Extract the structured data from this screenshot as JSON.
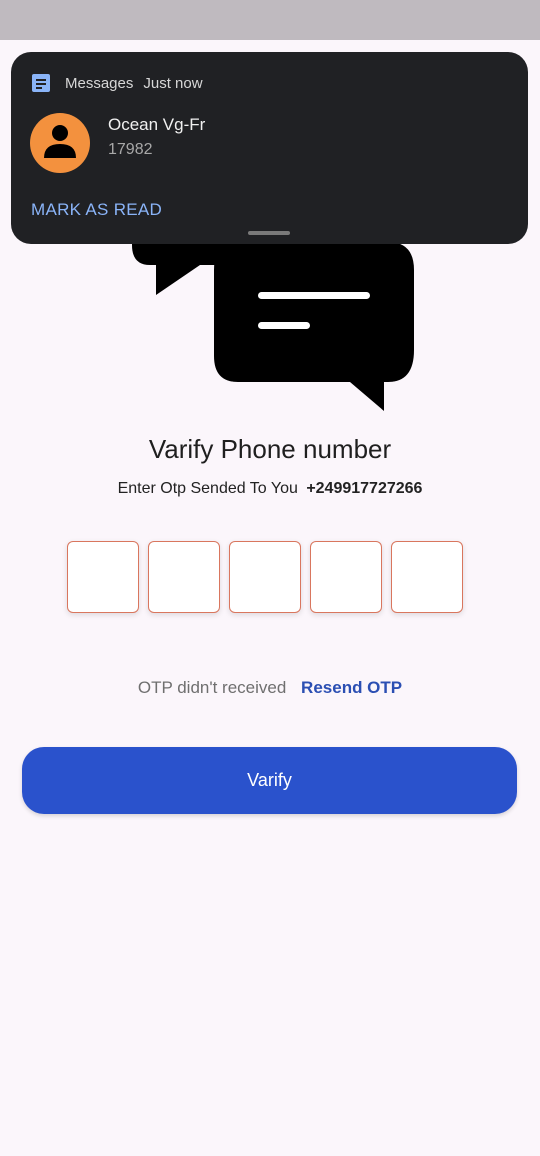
{
  "notification": {
    "app_name": "Messages",
    "time": "Just now",
    "sender": "Ocean Vg-Fr",
    "message": "17982",
    "action_label": "MARK AS READ",
    "icons": {
      "app": "messages-icon",
      "avatar": "person-icon"
    },
    "colors": {
      "background": "#202124",
      "action": "#8ab4f8",
      "avatar": "#f3913e"
    }
  },
  "verify": {
    "title": "Varify Phone number",
    "subtitle": "Enter Otp Sended To You",
    "phone": "+249917727266",
    "otp_boxes": [
      "",
      "",
      "",
      "",
      ""
    ],
    "resend_prompt": "OTP didn't received",
    "resend_label": "Resend OTP",
    "button_label": "Varify",
    "illustration_icon": "chat-bubbles-icon",
    "colors": {
      "accent": "#2a52cc",
      "otp_border": "#d9765e",
      "background": "#fbf6fb"
    }
  }
}
